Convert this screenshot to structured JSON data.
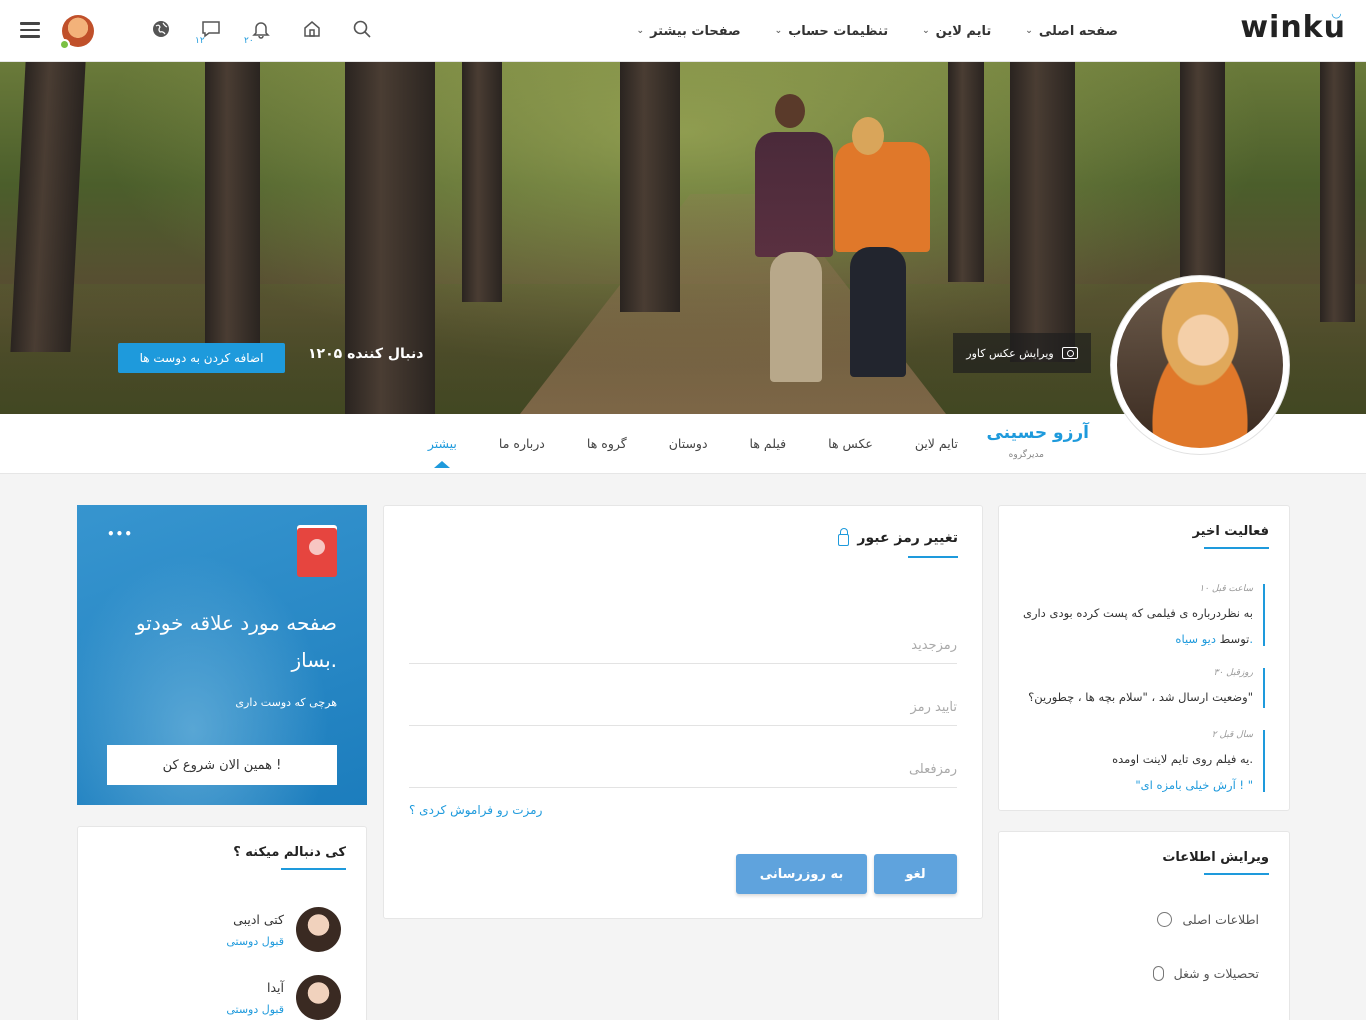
{
  "header": {
    "logo": "winku",
    "nav": [
      {
        "label": "صفحه اصلی"
      },
      {
        "label": "تایم لاین"
      },
      {
        "label": "تنظیمات حساب"
      },
      {
        "label": "صفحات بیشتر"
      }
    ],
    "messages_count": "۱۲",
    "notifications_count": "۲۰"
  },
  "cover": {
    "followers_text": "۱۲۰۵ دنبال کننده",
    "add_friend_label": "اضافه کردن به دوست ها",
    "edit_cover_label": "ویرایش عکس کاور"
  },
  "profile": {
    "name": "آرزو حسینی",
    "role": "مدیرگروه",
    "tabs": [
      {
        "label": "تایم لاین"
      },
      {
        "label": "عکس ها"
      },
      {
        "label": "فیلم ها"
      },
      {
        "label": "دوستان"
      },
      {
        "label": "گروه ها"
      },
      {
        "label": "درباره ما"
      },
      {
        "label": "بیشتر"
      }
    ]
  },
  "recent_activity": {
    "title": "فعالیت اخیر",
    "items": [
      {
        "time": "۱۰ ساعت قبل",
        "text": "به نظردرباره ی فیلمی که پست کرده بودی داری",
        "by_prefix": "توسط",
        "by_link": "دیو سیاه."
      },
      {
        "time": "۳۰ روزقبل",
        "text": "وضعیت ارسال شد ، \"سلام بچه ها ، چطورین؟\""
      },
      {
        "time": "۲ سال قبل",
        "text": "یه فیلم روی تایم لاینت اومده.",
        "quote": "\"آرش خیلی بامزه ای ! \""
      }
    ]
  },
  "edit_info": {
    "title": "ویرایش اطلاعات",
    "items": [
      {
        "label": "اطلاعات اصلی",
        "icon": "info-icon"
      },
      {
        "label": "تحصیلات و شغل",
        "icon": "mouse-icon"
      }
    ]
  },
  "password": {
    "title": "تغییر رمز عبور",
    "new_placeholder": "رمزجدید",
    "confirm_placeholder": "تأیید رمز",
    "current_placeholder": "رمزفعلی",
    "forgot": "رمزت رو فراموش کردی ؟",
    "update_label": "به روزرسانی",
    "cancel_label": "لغو"
  },
  "promo": {
    "headline": "صفحه مورد علاقه خودتو بساز.",
    "sub": "هرچی که دوست داری",
    "cta": "همین الان شروع کن !"
  },
  "followers_widget": {
    "title": "کی دنبالم میکنه ؟",
    "items": [
      {
        "name": "کتی ادیبی",
        "action": "قبول دوستی"
      },
      {
        "name": "آیدا",
        "action": "قبول دوستی"
      }
    ]
  },
  "colors": {
    "accent": "#1e9adc",
    "button": "#5fa3dd"
  }
}
